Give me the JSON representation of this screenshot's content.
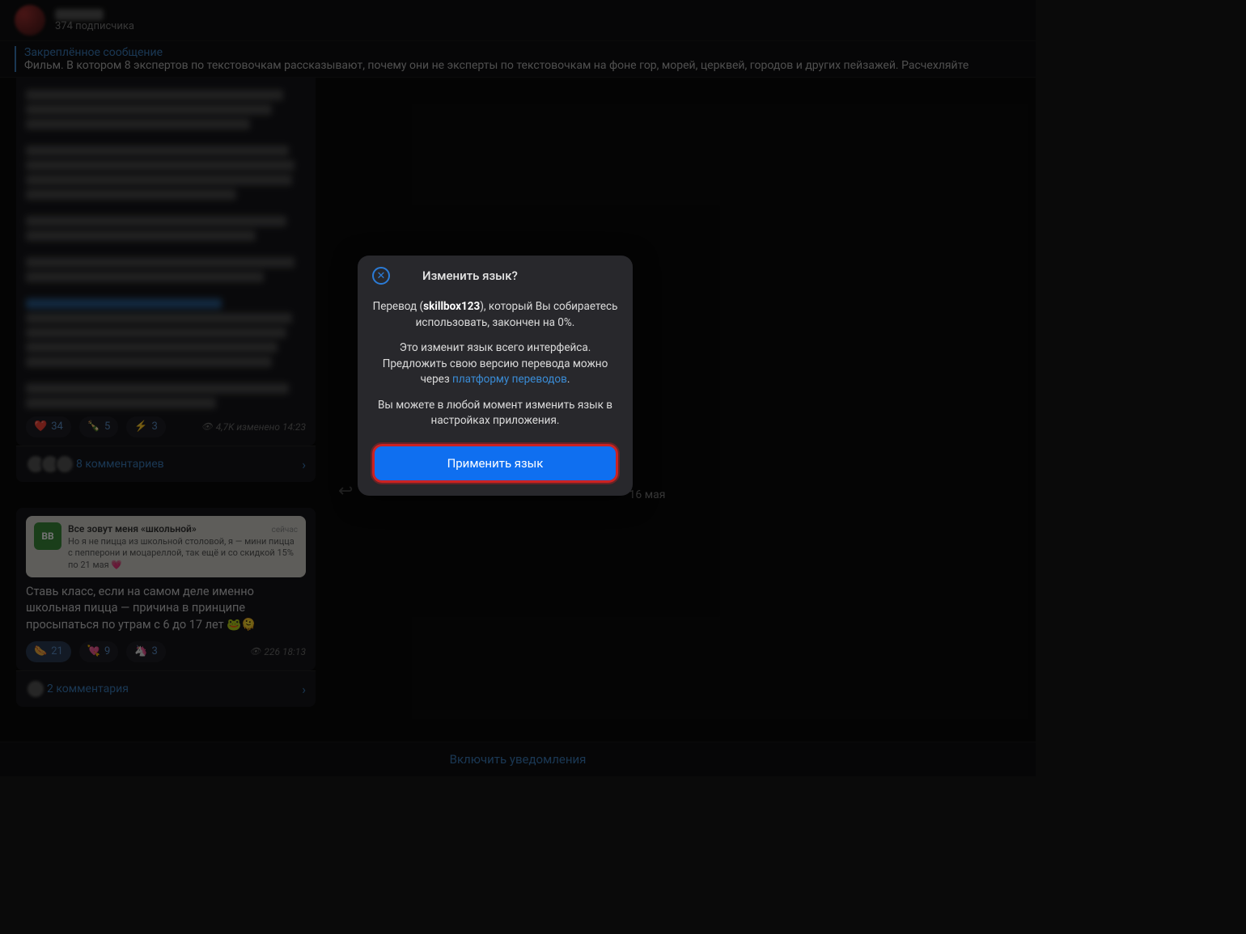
{
  "header": {
    "subscribers": "374 подписчика"
  },
  "pinned": {
    "title": "Закреплённое сообщение",
    "text": "Фильм. В котором 8 экспертов по текстовочкам рассказывают, почему они не эксперты по текстовочкам на фоне гор, морей, церквей, городов и других пейзажей. Расчехляйте"
  },
  "msg1": {
    "reactions": [
      {
        "emoji": "❤️",
        "count": "34"
      },
      {
        "emoji": "🍾",
        "count": "5"
      },
      {
        "emoji": "⚡",
        "count": "3"
      }
    ],
    "views": "4,7K изменено 14:23",
    "comments": "8 комментариев"
  },
  "date_separator": "16 мая",
  "msg2": {
    "embed": {
      "badge": "ВВ",
      "title": "Все зовут меня «школьной»",
      "text": "Но я не пицца из школьной столовой, я — мини пицца с пепперони и моцареллой, так ещё и со скидкой 15% по 21 мая 💗",
      "time": "сейчас"
    },
    "body": "Ставь класс, если на самом деле именно школьная пицца — причина в принципе просыпаться по утрам с 6 до 17 лет 🐸🫠",
    "reactions": [
      {
        "emoji": "🌭",
        "count": "21"
      },
      {
        "emoji": "💘",
        "count": "9"
      },
      {
        "emoji": "🦄",
        "count": "3"
      }
    ],
    "views": "226 18:13",
    "comments": "2 комментария"
  },
  "footer": {
    "notify": "Включить уведомления"
  },
  "modal": {
    "title": "Изменить язык?",
    "p1_a": "Перевод (",
    "p1_b": "skillbox123",
    "p1_c": "), который Вы собираетесь использовать, закончен на 0%.",
    "p2_a": "Это изменит язык всего интерфейса. Предложить свою версию перевода можно через ",
    "p2_link": "платформу переводов",
    "p2_b": ".",
    "p3": "Вы можете в любой момент изменить язык в настройках приложения.",
    "apply": "Применить язык"
  }
}
